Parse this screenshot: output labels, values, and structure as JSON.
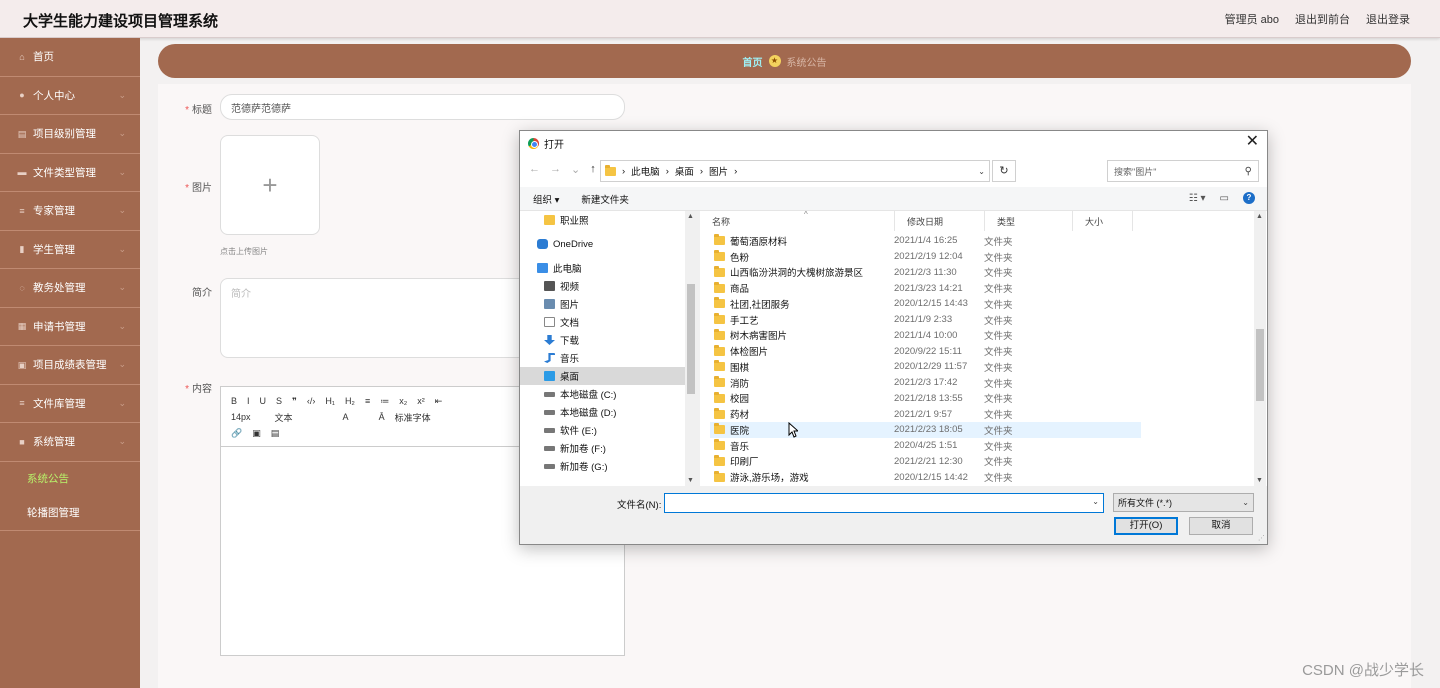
{
  "app": {
    "title": "大学生能力建设项目管理系统"
  },
  "header": {
    "links": [
      "管理员 abo",
      "退出到前台",
      "退出登录"
    ]
  },
  "sidebar": {
    "items": [
      {
        "label": "首页",
        "icon": "home-icon",
        "chev": false
      },
      {
        "label": "个人中心",
        "icon": "user-icon",
        "chev": true
      },
      {
        "label": "项目级别管理",
        "icon": "chat-icon",
        "chev": true
      },
      {
        "label": "文件类型管理",
        "icon": "car-icon",
        "chev": true
      },
      {
        "label": "专家管理",
        "icon": "list-icon",
        "chev": true
      },
      {
        "label": "学生管理",
        "icon": "bar-chart-icon",
        "chev": true
      },
      {
        "label": "教务处管理",
        "icon": "power-icon",
        "chev": true
      },
      {
        "label": "申请书管理",
        "icon": "grid-icon",
        "chev": true
      },
      {
        "label": "项目成绩表管理",
        "icon": "doc-icon",
        "chev": true
      },
      {
        "label": "文件库管理",
        "icon": "list-icon",
        "chev": true
      },
      {
        "label": "系统管理",
        "icon": "settings-icon",
        "chev": true
      }
    ],
    "subitems": [
      {
        "label": "系统公告",
        "active": true
      },
      {
        "label": "轮播图管理",
        "active": false
      }
    ]
  },
  "breadcrumb": {
    "home": "首页",
    "current": "系统公告"
  },
  "form": {
    "title_label": "标题",
    "title_value": "范德萨范德萨",
    "image_label": "图片",
    "upload_plus": "+",
    "upload_hint": "点击上传图片",
    "intro_label": "简介",
    "intro_placeholder": "简介",
    "content_label": "内容",
    "toolbar_row1": [
      "B",
      "I",
      "U",
      "S",
      "❞",
      "‹/›",
      "H₁",
      "H₂",
      "≡",
      "≔",
      "x₂",
      "x²",
      "⇤"
    ],
    "toolbar_row2": [
      "14px",
      "文本",
      "A",
      "Ā",
      "标准字体"
    ],
    "toolbar_row3": [
      "🔗",
      "▣",
      "▤"
    ]
  },
  "dialog": {
    "title": "打开",
    "close": "✕",
    "path": [
      "此电脑",
      "桌面",
      "图片"
    ],
    "search_placeholder": "搜索\"图片\"",
    "organize": "组织 ▾",
    "new_folder": "新建文件夹",
    "nav_tree": [
      {
        "label": "职业照",
        "icon": "folder",
        "indent": 24,
        "selected": false
      },
      {
        "label": "OneDrive",
        "icon": "cloud",
        "indent": 17,
        "selected": false
      },
      {
        "label": "此电脑",
        "icon": "pc",
        "indent": 17,
        "selected": false
      },
      {
        "label": "视频",
        "icon": "video",
        "indent": 24,
        "selected": false
      },
      {
        "label": "图片",
        "icon": "picture",
        "indent": 24,
        "selected": false
      },
      {
        "label": "文档",
        "icon": "doc",
        "indent": 24,
        "selected": false
      },
      {
        "label": "下载",
        "icon": "download",
        "indent": 24,
        "selected": false
      },
      {
        "label": "音乐",
        "icon": "music",
        "indent": 24,
        "selected": false
      },
      {
        "label": "桌面",
        "icon": "desktop",
        "indent": 24,
        "selected": true
      },
      {
        "label": "本地磁盘 (C:)",
        "icon": "drive",
        "indent": 24,
        "selected": false
      },
      {
        "label": "本地磁盘 (D:)",
        "icon": "drive",
        "indent": 24,
        "selected": false
      },
      {
        "label": "软件 (E:)",
        "icon": "drive",
        "indent": 24,
        "selected": false
      },
      {
        "label": "新加卷 (F:)",
        "icon": "drive",
        "indent": 24,
        "selected": false
      },
      {
        "label": "新加卷 (G:)",
        "icon": "drive",
        "indent": 24,
        "selected": false
      }
    ],
    "columns": [
      "名称",
      "修改日期",
      "类型",
      "大小"
    ],
    "files": [
      {
        "name": "葡萄酒原材料",
        "date": "2021/1/4 16:25",
        "type": "文件夹"
      },
      {
        "name": "色粉",
        "date": "2021/2/19 12:04",
        "type": "文件夹"
      },
      {
        "name": "山西临汾洪洞的大槐树旅游景区",
        "date": "2021/2/3 11:30",
        "type": "文件夹"
      },
      {
        "name": "商品",
        "date": "2021/3/23 14:21",
        "type": "文件夹"
      },
      {
        "name": "社团,社团服务",
        "date": "2020/12/15 14:43",
        "type": "文件夹"
      },
      {
        "name": "手工艺",
        "date": "2021/1/9 2:33",
        "type": "文件夹"
      },
      {
        "name": "树木病害图片",
        "date": "2021/1/4 10:00",
        "type": "文件夹"
      },
      {
        "name": "体检图片",
        "date": "2020/9/22 15:11",
        "type": "文件夹"
      },
      {
        "name": "围棋",
        "date": "2020/12/29 11:57",
        "type": "文件夹"
      },
      {
        "name": "消防",
        "date": "2021/2/3 17:42",
        "type": "文件夹"
      },
      {
        "name": "校园",
        "date": "2021/2/18 13:55",
        "type": "文件夹"
      },
      {
        "name": "药材",
        "date": "2021/2/1 9:57",
        "type": "文件夹"
      },
      {
        "name": "医院",
        "date": "2021/2/23 18:05",
        "type": "文件夹",
        "hover": true
      },
      {
        "name": "音乐",
        "date": "2020/4/25 1:51",
        "type": "文件夹"
      },
      {
        "name": "印刷厂",
        "date": "2021/2/21 12:30",
        "type": "文件夹"
      },
      {
        "name": "游泳,游乐场，游戏",
        "date": "2020/12/15 14:42",
        "type": "文件夹"
      }
    ],
    "filename_label": "文件名(N):",
    "filename_value": "",
    "filter": "所有文件 (*.*)",
    "open_btn": "打开(O)",
    "cancel_btn": "取消"
  },
  "watermark": "CSDN @战少学长",
  "colors": {
    "accent": "#a2694f",
    "active_sub": "#b8f26a",
    "crumb_home": "#9ff0f5"
  }
}
